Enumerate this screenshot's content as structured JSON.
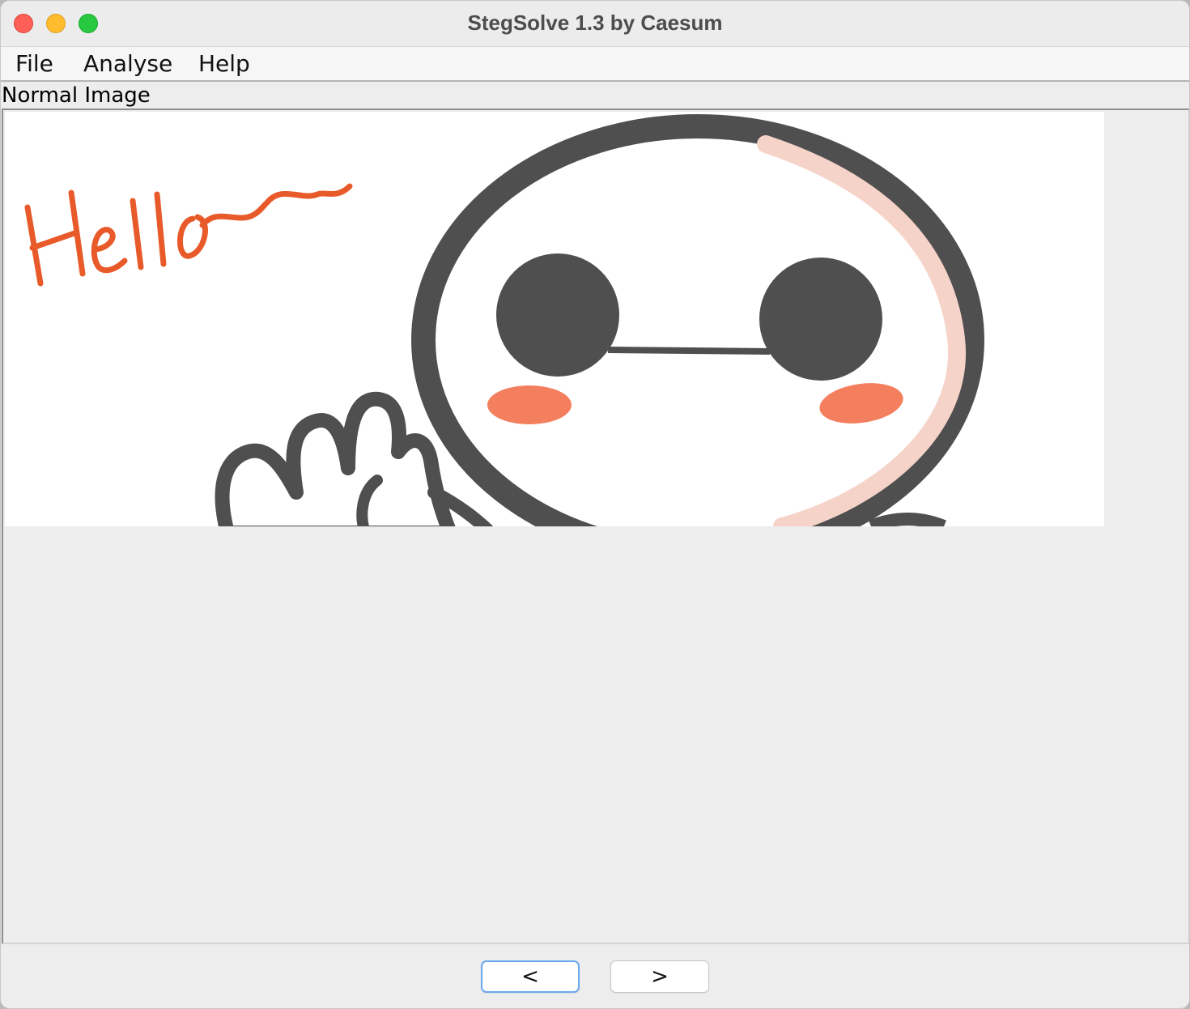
{
  "window": {
    "title": "StegSolve 1.3 by Caesum"
  },
  "menubar": {
    "items": [
      {
        "label": "File"
      },
      {
        "label": "Analyse"
      },
      {
        "label": "Help"
      }
    ]
  },
  "viewer": {
    "mode_label": "Normal Image",
    "image": {
      "handwritten_text": "Hello~~",
      "colors": {
        "outline": "#4f4f4f",
        "blush": "#f47f5e",
        "highlight": "#f6d3c9",
        "handwriting": "#e85a2a",
        "background": "#ffffff"
      }
    }
  },
  "navigation": {
    "prev_label": "<",
    "next_label": ">"
  },
  "theme": {
    "window_bg": "#ededed",
    "focus_ring": "#6aa8f0"
  }
}
